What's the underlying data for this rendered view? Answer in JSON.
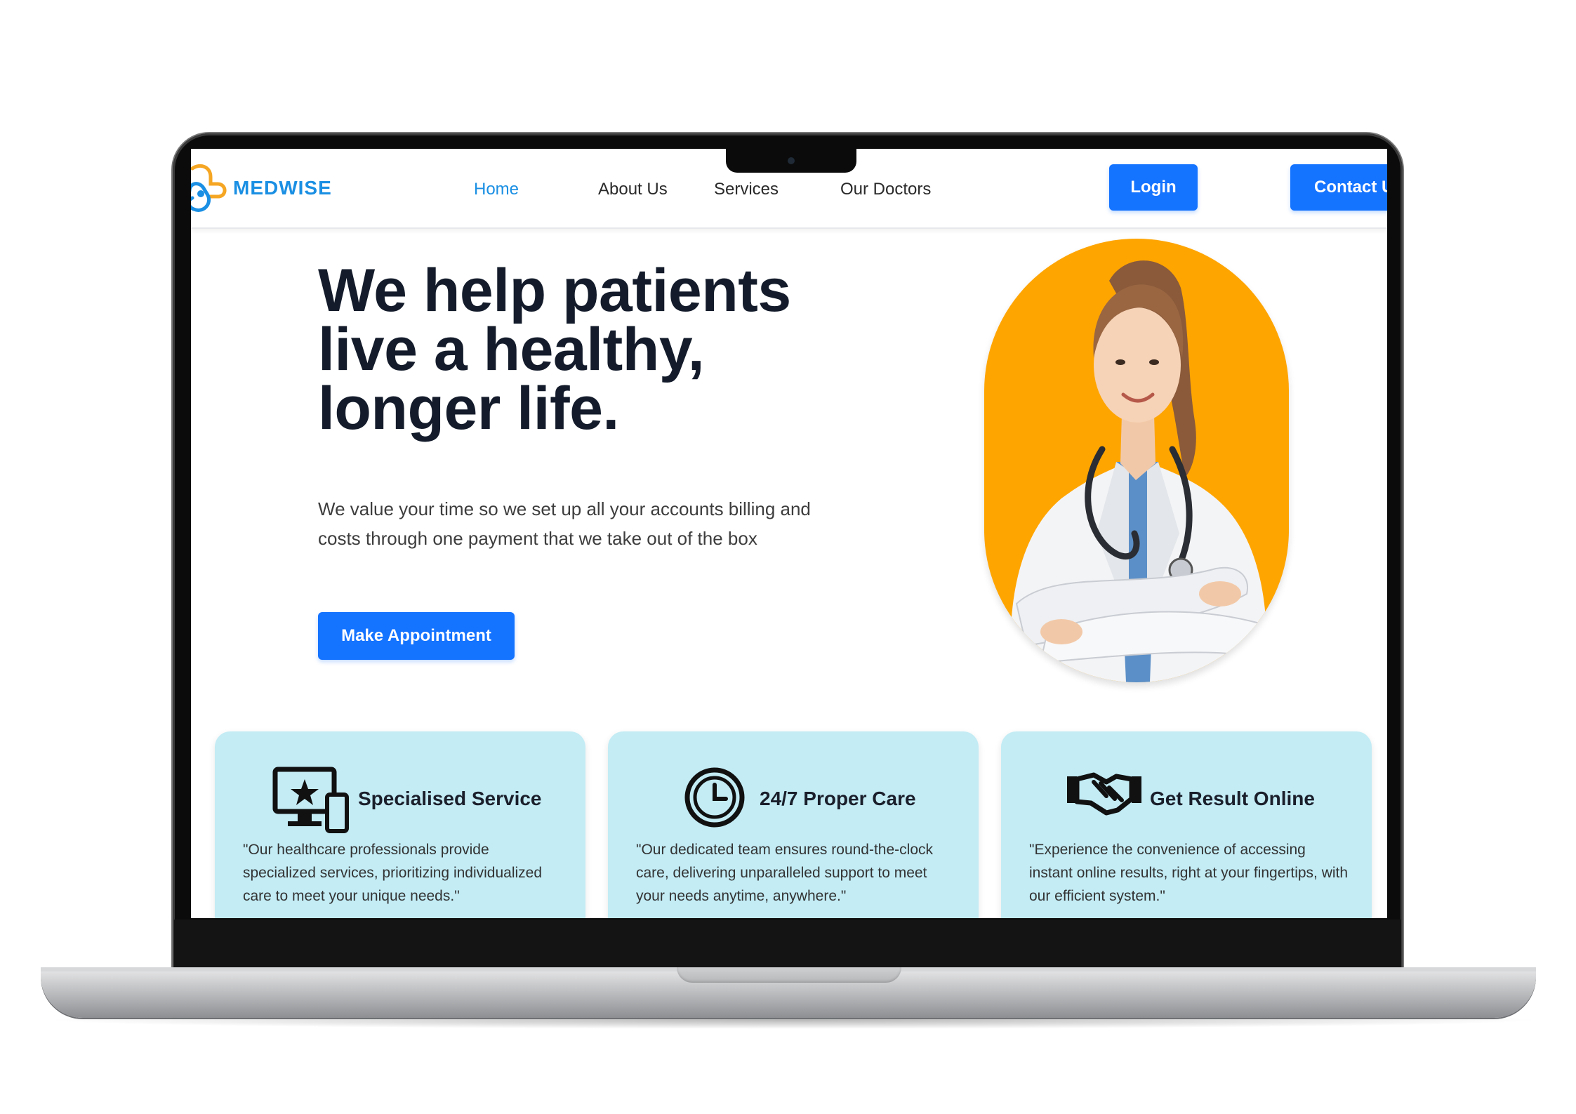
{
  "brand": {
    "name": "MEDWISE",
    "accent": "#1a8fe3",
    "button_blue": "#1473ff"
  },
  "nav": {
    "links": [
      {
        "label": "Home",
        "active": true
      },
      {
        "label": "About Us",
        "active": false
      },
      {
        "label": "Services",
        "active": false
      },
      {
        "label": "Our Doctors",
        "active": false
      }
    ],
    "login_label": "Login",
    "contact_label": "Contact Us"
  },
  "hero": {
    "title": "We help patients live a healthy, longer life.",
    "subtitle": "We value your time so we set up all your accounts billing and costs through one payment that we take out of the box",
    "cta_label": "Make Appointment",
    "photo_bg": "#ffa500",
    "photo_subject": "doctor-portrait"
  },
  "services": [
    {
      "icon": "devices-star-icon",
      "title": "Specialised Service",
      "text": "\"Our healthcare professionals provide specialized services, prioritizing individualized care to meet your unique needs.\""
    },
    {
      "icon": "clock-icon",
      "title": "24/7 Proper Care",
      "text": "\"Our dedicated team ensures round-the-clock care, delivering unparalleled support to meet your needs anytime, anywhere.\""
    },
    {
      "icon": "handshake-icon",
      "title": "Get Result Online",
      "text": "\"Experience the convenience of accessing instant online results, right at your fingertips, with our efficient system.\""
    }
  ],
  "card_bg": "#c3ecf5"
}
